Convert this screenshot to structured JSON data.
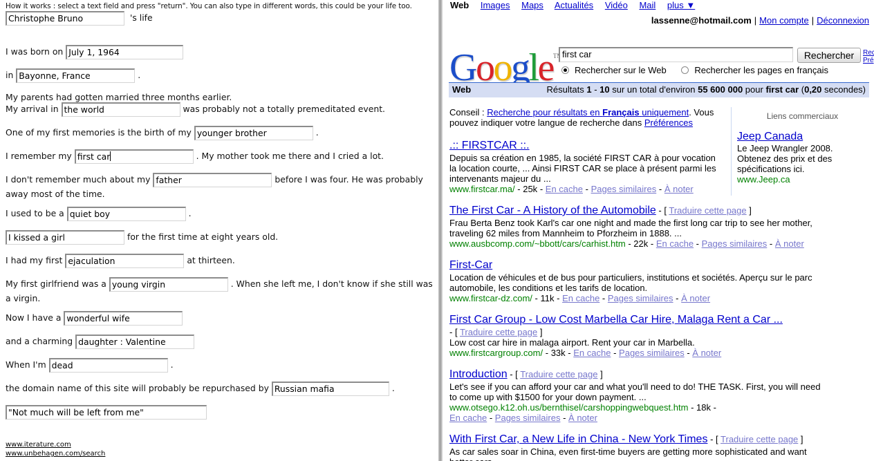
{
  "story": {
    "hint": "How it works : select a text field and press \"return\". You can also type in different words, this could be your life too.",
    "name_value": "Christophe Bruno",
    "name_suffix": "'s life",
    "born_prefix": "I was born on",
    "born_value": "July 1, 1964",
    "in_prefix": "in",
    "in_value": "Bayonne, France",
    "period": ".",
    "parents_line": "My parents had gotten married three months earlier.",
    "arrival_prefix": "My arrival in",
    "arrival_value": "the world",
    "arrival_suffix": "was probably not a totally premeditated event.",
    "memory_prefix": "One of my first memories is the birth of my",
    "memory_value": "younger brother",
    "remember_prefix": "I remember my",
    "remember_value": "first car",
    "remember_suffix": ". My mother took me there and I cried a lot.",
    "dont_prefix": "I don't remember much about my",
    "dont_value": "father",
    "dont_suffix": "before I was four. He was probably away most of the time.",
    "used_prefix": "I used to be a",
    "used_value": "quiet boy",
    "kissed_value": "I kissed a girl",
    "kissed_suffix": "for the first time at eight years old.",
    "had_prefix": "I had my first",
    "had_value": "ejaculation",
    "had_suffix": "at thirteen.",
    "gf_prefix": "My first girlfriend was a",
    "gf_value": "young virgin",
    "gf_suffix": ". When she left me, I don't know if she still was a virgin.",
    "now_prefix": "Now I have a",
    "now_value": "wonderful wife",
    "charming_prefix": "and a charming",
    "charming_value": "daughter : Valentine",
    "when_prefix": "When I'm",
    "when_value": "dead",
    "domain_prefix": "the domain name of this site will probably be repurchased by",
    "domain_value": "Russian mafia",
    "last_value": "\"Not much will be left from me\"",
    "links": [
      "www.iterature.com",
      "www.unbehagen.com/search"
    ]
  },
  "google": {
    "nav": {
      "active": "Web",
      "items": [
        "Images",
        "Maps",
        "Actualités",
        "Vidéo",
        "Mail",
        "plus ▼"
      ]
    },
    "account": {
      "email": "lassenne@hotmail.com",
      "sep": "|",
      "links": [
        "Mon compte",
        "Déconnexion"
      ]
    },
    "logo": {
      "G": "G",
      "o1": "o",
      "o2": "o",
      "g": "g",
      "l": "l",
      "e": "e",
      "tm": "TM"
    },
    "query": "first car",
    "search_button": "Rechercher",
    "advanced": [
      "Rec",
      "Pré"
    ],
    "radio_web": "Rechercher sur le Web",
    "radio_fr": "Rechercher les pages en français",
    "bar_label": "Web",
    "stats": {
      "t1": "Résultats ",
      "a": "1",
      "t2": " - ",
      "b": "10",
      "t3": " sur un total d'environ ",
      "c": "55 600 000",
      "t4": " pour ",
      "q": "first car",
      "t5": " (",
      "secs": "0,20",
      "t6": " secondes)"
    },
    "tip": {
      "label": "Conseil :",
      "link1": "Recherche pour résultats en",
      "fr": "Français",
      "uniq": "uniquement",
      "mid": ". Vous pouvez indiquer votre langue de recherche dans",
      "link2": "Préférences"
    },
    "ads": {
      "header": "Liens commerciaux",
      "title": "Jeep Canada",
      "desc": "Le Jeep Wrangler 2008. Obtenez des prix et des spécifications ici.",
      "url": "www.Jeep.ca"
    },
    "common": {
      "cache": "En cache",
      "similar": "Pages similaires",
      "note": "À noter",
      "translate": "Traduire cette page",
      "dash": "-",
      "lb": "- [",
      "rb": "]"
    },
    "results": [
      {
        "title": ".:: FIRSTCAR ::.",
        "desc": "Depuis sa création en 1985, la société FIRST CAR à pour vocation la location courte, ... Ainsi FIRST CAR se place à présent parmi les intervenants majeur du ...",
        "url": "www.firstcar.ma/",
        "size": "25k"
      },
      {
        "title": "The First Car - A History of the Automobile",
        "desc": "Frau Berta Benz took Karl's car one night and made the first long car trip to see her mother, traveling 62 miles from Mannheim to Pforzheim in 1888. ...",
        "url": "www.ausbcomp.com/~bbott/cars/carhist.htm",
        "size": "22k"
      },
      {
        "title": "First-Car",
        "desc": "Location de véhicules et de bus pour particuliers, institutions et sociétés. Aperçu sur le parc automobile, les conditions et les tarifs de location.",
        "url": "www.firstcar-dz.com/",
        "size": "11k"
      },
      {
        "title": "First Car Group - Low Cost Marbella Car Hire, Malaga Rent a Car ...",
        "desc": "Low cost car hire in malaga airport. Rent your car in Marbella.",
        "url": "www.firstcargroup.com/",
        "size": "33k"
      },
      {
        "title": "Introduction",
        "desc": "Let's see if you can afford your car and what you'll need to do! THE TASK. First, you will need to come up with $1500 for your down payment. ...",
        "url": "www.otsego.k12.oh.us/bernthisel/carshoppingwebquest.htm",
        "size": "18k"
      },
      {
        "title": "With First Car, a New Life in China - New York Times",
        "desc": "As car sales soar in China, even first-time buyers are getting more sophisticated and want better cars ..."
      }
    ]
  },
  "colors": {
    "blue": "#0000cc",
    "green": "#008000",
    "bar": "#d5ddf3",
    "logo_blue": "#1c4ec9",
    "logo_red": "#d8242a",
    "logo_yellow": "#efb300",
    "logo_green": "#1f9d3a"
  }
}
